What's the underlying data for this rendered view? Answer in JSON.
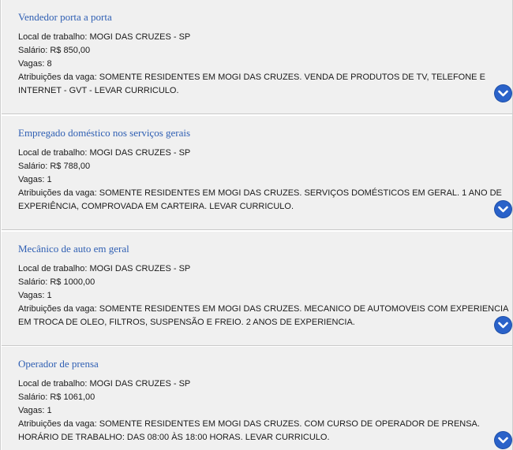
{
  "jobs": [
    {
      "title": "Vendedor porta a porta",
      "local": "Local de trabalho: MOGI DAS CRUZES - SP",
      "salario": "Salário: R$ 850,00",
      "vagas": "Vagas: 8",
      "atribuicoes": "Atribuições da vaga: SOMENTE RESIDENTES EM MOGI DAS CRUZES. VENDA DE PRODUTOS DE TV, TELEFONE E INTERNET - GVT - LEVAR CURRICULO.",
      "expand_icon": "chevron-down-icon"
    },
    {
      "title": "Empregado doméstico nos serviços gerais",
      "local": "Local de trabalho: MOGI DAS CRUZES - SP",
      "salario": "Salário: R$ 788,00",
      "vagas": "Vagas: 1",
      "atribuicoes": "Atribuições da vaga: SOMENTE RESIDENTES EM MOGI DAS CRUZES. SERVIÇOS DOMÉSTICOS EM GERAL. 1 ANO DE EXPERIÊNCIA, COMPROVADA EM CARTEIRA. LEVAR CURRICULO.",
      "expand_icon": "chevron-down-icon"
    },
    {
      "title": "Mecânico de auto em geral",
      "local": "Local de trabalho: MOGI DAS CRUZES - SP",
      "salario": "Salário: R$ 1000,00",
      "vagas": "Vagas: 1",
      "atribuicoes": "Atribuições da vaga: SOMENTE RESIDENTES EM MOGI DAS CRUZES. MECANICO DE AUTOMOVEIS COM EXPERIENCIA EM TROCA DE OLEO, FILTROS, SUSPENSÃO E FREIO. 2 ANOS DE EXPERIENCIA.",
      "expand_icon": "chevron-down-icon"
    },
    {
      "title": "Operador de prensa",
      "local": "Local de trabalho: MOGI DAS CRUZES - SP",
      "salario": "Salário: R$ 1061,00",
      "vagas": "Vagas: 1",
      "atribuicoes": "Atribuições da vaga: SOMENTE RESIDENTES EM MOGI DAS CRUZES. COM CURSO DE OPERADOR DE PRENSA. HORÁRIO DE TRABALHO: DAS 08:00 ÀS 18:00 HORAS. LEVAR CURRICULO.",
      "expand_icon": "chevron-down-icon"
    }
  ],
  "colors": {
    "card_background": "#f0f0f0",
    "title": "#2f5fb3",
    "expand_button": "#2a62c9"
  }
}
